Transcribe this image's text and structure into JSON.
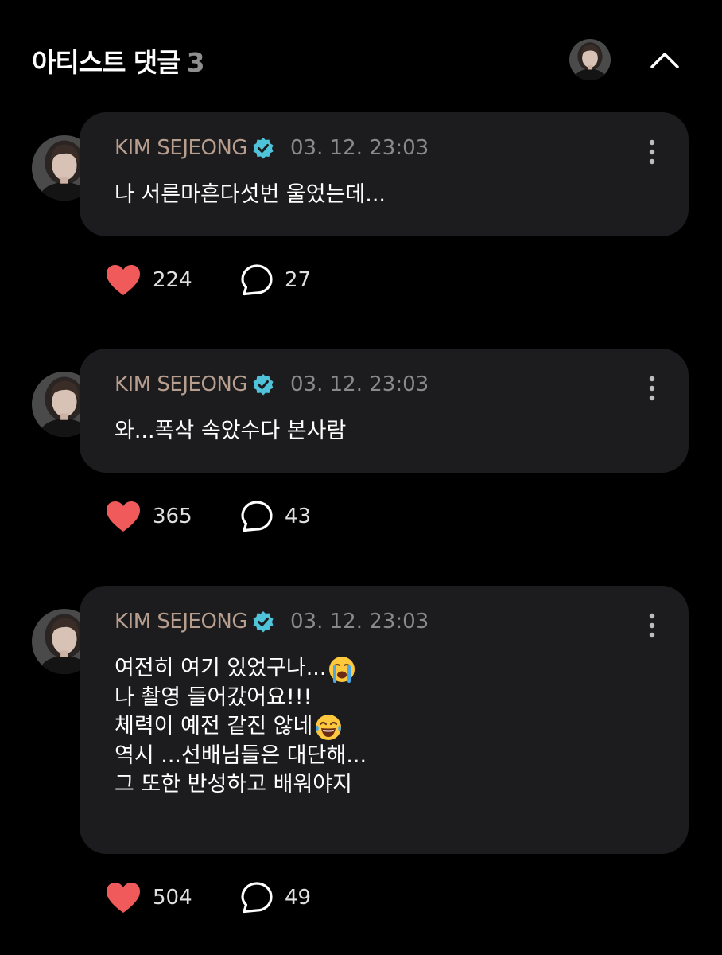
{
  "header": {
    "title": "아티스트 댓글",
    "count": "3"
  },
  "comments": [
    {
      "author": "KIM SEJEONG",
      "time": "03. 12. 23:03",
      "lines": [
        "나 서른마흔다섯번 울었는데..."
      ],
      "likes": "224",
      "replies": "27"
    },
    {
      "author": "KIM SEJEONG",
      "time": "03. 12. 23:03",
      "lines": [
        "와...폭삭 속았수다 본사람"
      ],
      "likes": "365",
      "replies": "43"
    },
    {
      "author": "KIM SEJEONG",
      "time": "03. 12. 23:03",
      "lines": [
        "여전히 여기 있었구나...",
        "나 촬영 들어갔어요!!!",
        "체력이 예전 같진 않네",
        "역시 ...선배님들은 대단해...",
        "그 또한 반성하고 배워야지"
      ],
      "likes": "504",
      "replies": "49"
    }
  ],
  "icons": {
    "verified": "verified-badge-icon",
    "more": "more-vertical-icon",
    "like": "heart-icon",
    "reply": "speech-bubble-icon",
    "collapse": "chevron-up-icon",
    "crying_emoji": "loudly-crying-face-emoji",
    "laughing_emoji": "tears-of-joy-emoji"
  },
  "colors": {
    "background": "#000000",
    "bubble": "#1c1c1e",
    "author": "#b89e8e",
    "timestamp": "#8a8a8a",
    "heart": "#f05a5a",
    "verified": "#4fc3d9"
  }
}
